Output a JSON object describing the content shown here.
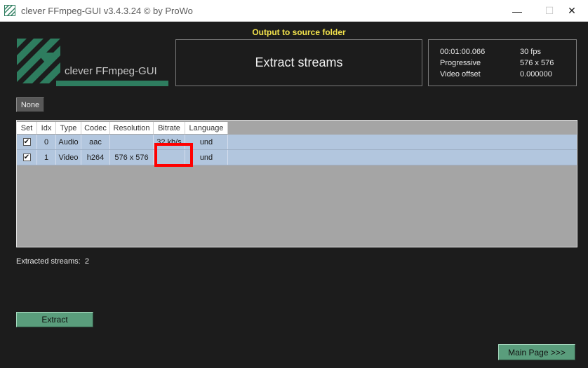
{
  "window": {
    "title": "clever FFmpeg-GUI v3.4.3.24   © by ProWo",
    "min_glyph": "—",
    "max_glyph": "☐",
    "close_glyph": "✕"
  },
  "logo": {
    "text": "clever FFmpeg-GUI",
    "color": "#2e7d5f"
  },
  "output_label": "Output to source folder",
  "mode_title": "Extract streams",
  "info": [
    {
      "label": "00:01:00.066",
      "value": "30 fps"
    },
    {
      "label": "Progressive",
      "value": "576 x 576"
    },
    {
      "label": "Video offset",
      "value": "0.000000"
    }
  ],
  "buttons": {
    "none": "None",
    "extract": "Extract",
    "main_page": "Main Page >>>"
  },
  "table": {
    "headers": [
      "Set",
      "Idx",
      "Type",
      "Codec",
      "Resolution",
      "Bitrate",
      "Language"
    ],
    "rows": [
      {
        "set": "✔",
        "idx": "0",
        "type": "Audio",
        "codec": "aac",
        "resolution": "",
        "bitrate": "32 kb/s",
        "language": "und"
      },
      {
        "set": "✔",
        "idx": "1",
        "type": "Video",
        "codec": "h264",
        "resolution": "576 x 576",
        "bitrate": "",
        "language": "und"
      }
    ]
  },
  "status": {
    "label": "Extracted streams:",
    "count": "2"
  },
  "colors": {
    "accent_green": "#5a9d7c",
    "highlight": "#ff0000",
    "label_yellow": "#f2e24c",
    "row_blue": "#b2c6de"
  }
}
